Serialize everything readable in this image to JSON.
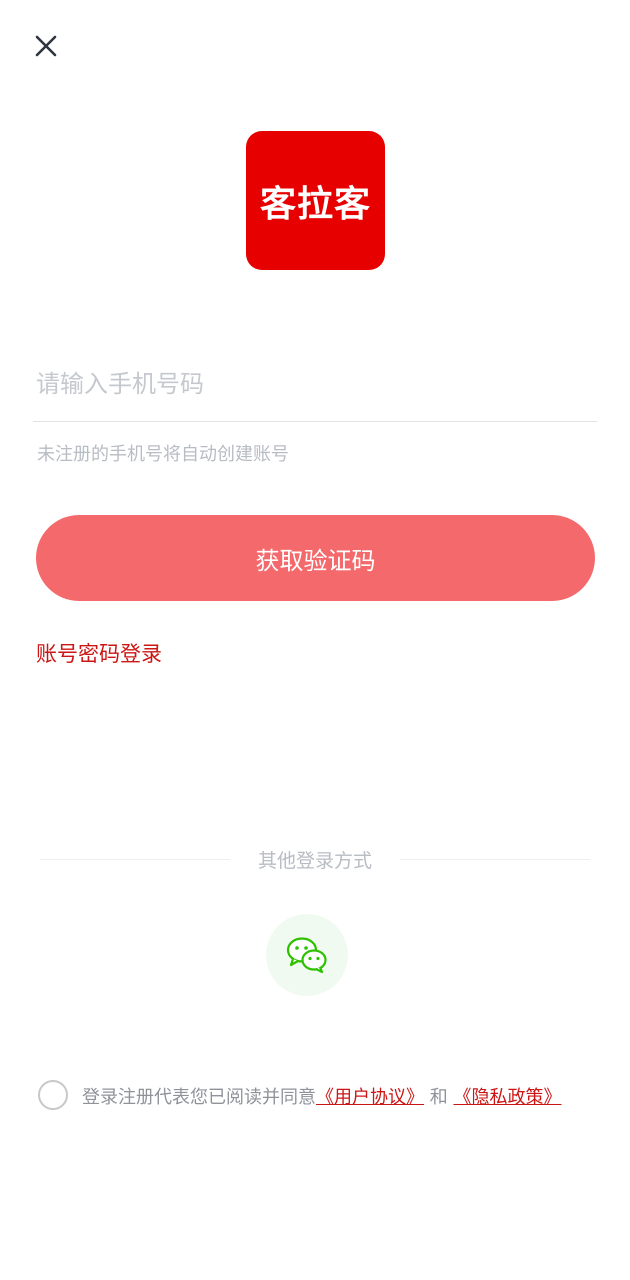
{
  "header": {
    "close_icon": "close-icon"
  },
  "logo": {
    "text": "客拉客",
    "color": "#e60000"
  },
  "phone": {
    "placeholder": "请输入手机号码",
    "value": "",
    "hint": "未注册的手机号将自动创建账号"
  },
  "actions": {
    "get_code_label": "获取验证码",
    "password_login_label": "账号密码登录"
  },
  "other_login": {
    "label": "其他登录方式",
    "wechat_icon": "wechat-icon"
  },
  "agreement": {
    "checked": false,
    "prefix": "登录注册代表您已阅读并同意",
    "user_agreement": "《用户协议》",
    "and": " 和 ",
    "privacy_policy": "《隐私政策》"
  },
  "colors": {
    "accent": "#cc1616",
    "button": "#f4696b",
    "wechat": "#2dc100"
  }
}
